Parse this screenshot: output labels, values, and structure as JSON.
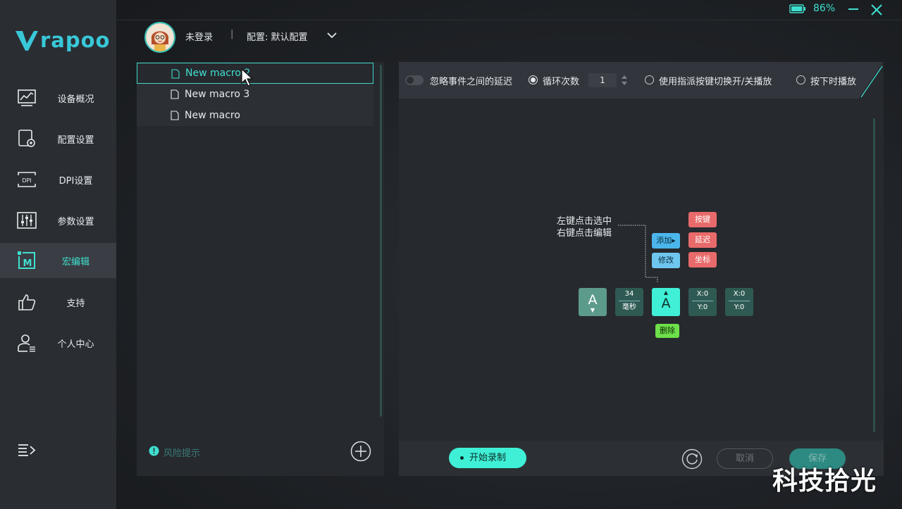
{
  "app": {
    "brand": "rapoo",
    "battery": "86%",
    "colors": {
      "accent": "#3fe0d0",
      "sidebar": "#2a2d32",
      "panel": "#26292e",
      "danger": "#e86a6a",
      "info": "#4bb6ea",
      "success": "#6ee04a"
    }
  },
  "header": {
    "login_status": "未登录",
    "separator": "|",
    "config_label": "配置: 默认配置"
  },
  "sidebar": {
    "items": [
      {
        "label": "设备概况",
        "icon": "device-overview-icon"
      },
      {
        "label": "配置设置",
        "icon": "config-settings-icon"
      },
      {
        "label": "DPI设置",
        "icon": "dpi-icon"
      },
      {
        "label": "参数设置",
        "icon": "sliders-icon"
      },
      {
        "label": "宏编辑",
        "icon": "macro-icon",
        "active": true
      },
      {
        "label": "支持",
        "icon": "thumbs-up-icon"
      },
      {
        "label": "个人中心",
        "icon": "user-center-icon"
      }
    ]
  },
  "macros": {
    "items": [
      {
        "label": "New macro 2",
        "selected": true
      },
      {
        "label": "New macro 3"
      },
      {
        "label": "New macro"
      }
    ],
    "risk_hint": "风险提示"
  },
  "toolbar": {
    "ignore_delay": "忽略事件之间的延迟",
    "loop_count_label": "循环次数",
    "loop_count_value": "1",
    "toggle_key_label": "使用指派按键切换开/关播放",
    "press_play_label": "按下时播放"
  },
  "editor": {
    "hint_line1": "左键点击选中",
    "hint_line2": "右键点击编辑",
    "menu": {
      "add": "添加",
      "modify": "修改",
      "key": "按键",
      "delay": "延迟",
      "coord": "坐标",
      "delete": "删除"
    },
    "blocks": [
      {
        "type": "key-down",
        "label": "A"
      },
      {
        "type": "delay",
        "value": "34",
        "unit": "毫秒"
      },
      {
        "type": "key-up",
        "label": "A"
      },
      {
        "type": "coord",
        "x": "X:0",
        "y": "Y:0"
      },
      {
        "type": "coord",
        "x": "X:0",
        "y": "Y:0"
      }
    ]
  },
  "footer": {
    "record": "开始录制",
    "cancel": "取消",
    "save": "保存"
  },
  "watermark": "科技拾光"
}
